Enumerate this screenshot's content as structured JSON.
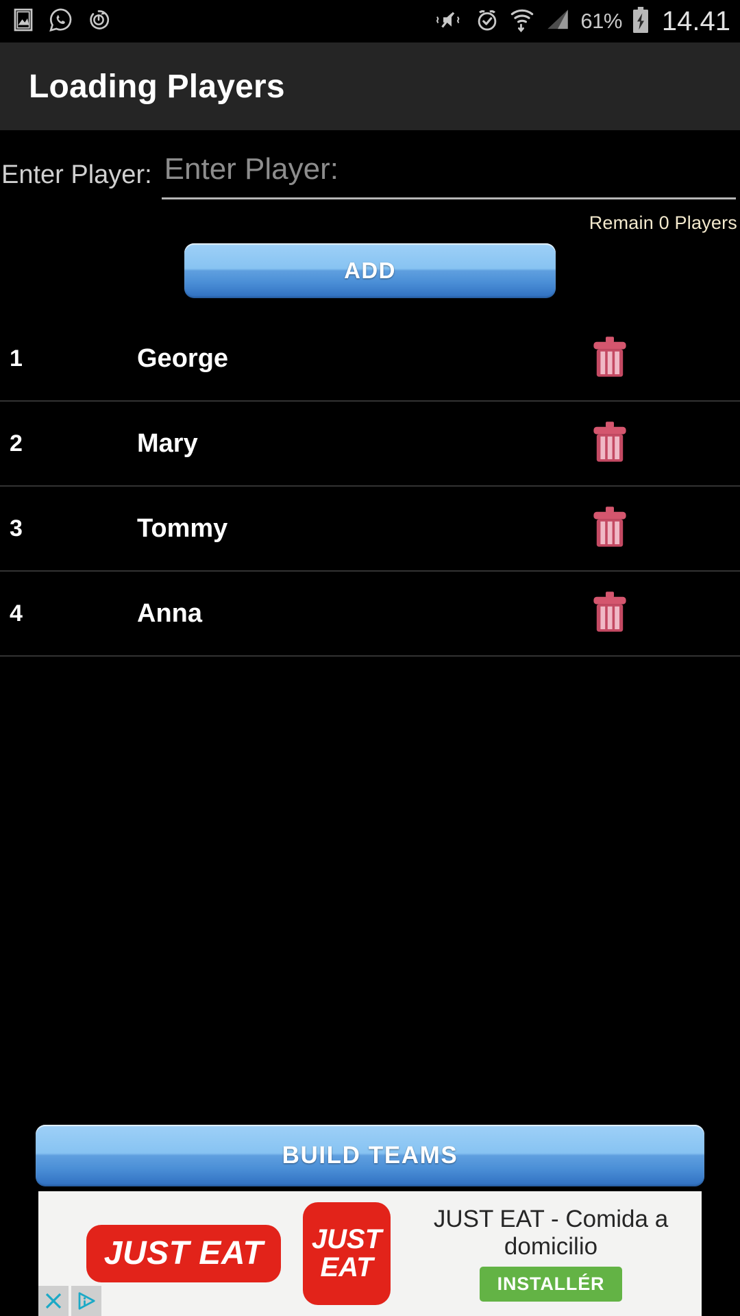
{
  "status_bar": {
    "icons_left": [
      "gallery-icon",
      "whatsapp-icon",
      "power-sync-icon"
    ],
    "icons_right": [
      "mute-vibrate-icon",
      "alarm-icon",
      "wifi-icon",
      "signal-icon"
    ],
    "battery_percent": "61%",
    "battery_state_icon": "battery-charging-icon",
    "clock": "14.41"
  },
  "app_bar": {
    "title": "Loading Players"
  },
  "form": {
    "label": "Enter Player:",
    "input_value": "",
    "input_placeholder": "Enter Player:",
    "remain_text": "Remain 0 Players",
    "remain_color": "#f3e9cd",
    "add_label": "ADD"
  },
  "player_list": {
    "rows": [
      {
        "index": "1",
        "name": "George",
        "delete_icon": "trash-icon"
      },
      {
        "index": "2",
        "name": "Mary",
        "delete_icon": "trash-icon"
      },
      {
        "index": "3",
        "name": "Tommy",
        "delete_icon": "trash-icon"
      },
      {
        "index": "4",
        "name": "Anna",
        "delete_icon": "trash-icon"
      }
    ]
  },
  "footer": {
    "build_label": "BUILD TEAMS"
  },
  "ad": {
    "logo_wide_text": "JUST EAT",
    "logo_square_line1": "JUST",
    "logo_square_line2": "EAT",
    "headline": "JUST EAT - Comida a domicilio",
    "cta_label": "INSTALLÉR",
    "close_icon": "close-icon",
    "adchoices_icon": "adchoices-icon",
    "brand_color": "#e2231a",
    "cta_color": "#63b345"
  }
}
